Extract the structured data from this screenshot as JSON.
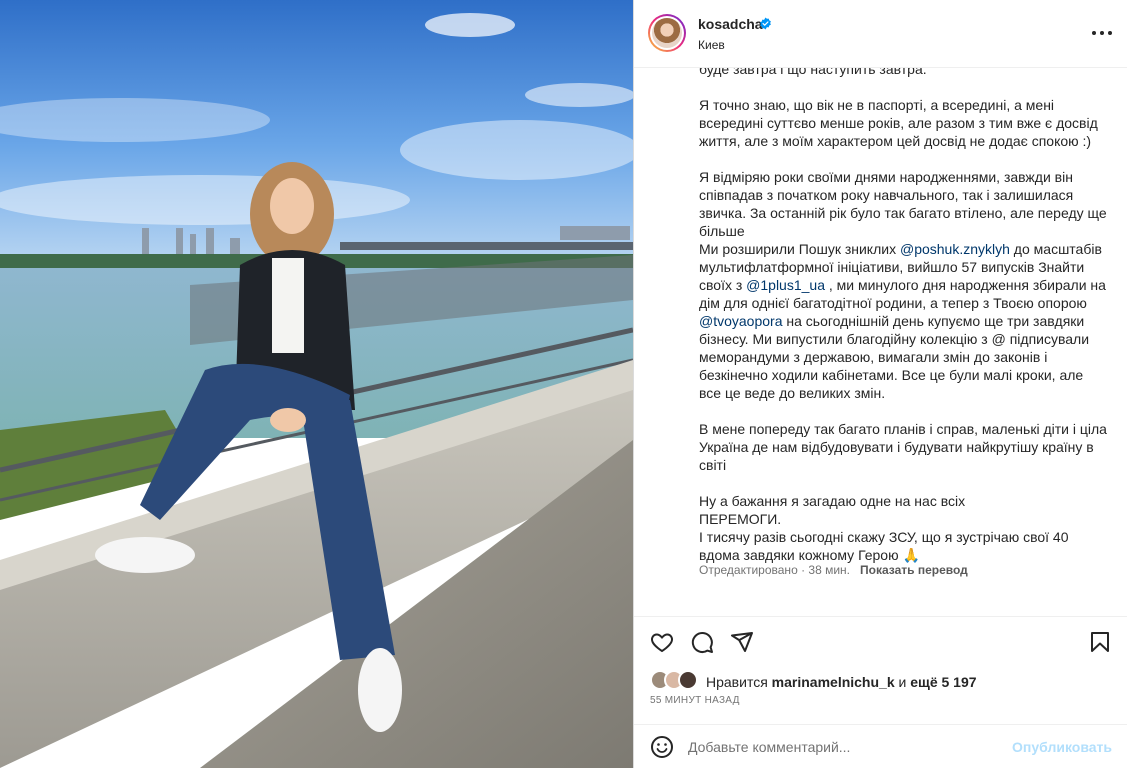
{
  "post": {
    "username": "kosadcha",
    "location": "Киев",
    "verified_color": "#0095f6",
    "caption": {
      "p0": "буде завтра і що наступить завтра.",
      "p1": "Я точно знаю, що вік не в паспорті, а всередині, а мені всередині суттєво менше років, але разом з тим вже є досвід життя, але з моїм характером цей досвід не додає спокою :)",
      "p2": "Я відміряю роки своїми днями народженнями, завжди він співпадав з початком року навчального, так і залишилася звичка. За останній рік було так багато втілено, але переду ще більше",
      "p3_a": "Ми розширили Пошук зниклих ",
      "mention1": "@poshuk.znyklyh",
      "p3_b": " до масштабів мультифлатформної ініціативи, вийшло 57 випусків Знайти своїх з ",
      "mention2": "@1plus1_ua",
      "p3_c": " , ми минулого дня народження збирали на дім для однієї багатодітної родини, а тепер з Твоєю опорою ",
      "mention3": "@tvoyaopora",
      "p3_d": " на сьогоднішній день купуємо ще три завдяки бізнесу. Ми випустили благодійну колекцію з @ підписували меморандуми з державою, вимагали змін до законів і безкінечно ходили кабінетами. Все це були малі кроки, але все це веде до великих змін.",
      "p4": "В мене попереду так багато планів і справ, маленькі діти і ціла Україна де нам відбудовувати і будувати найкрутішу країну в світі",
      "p5_l1": "Ну а бажання я загадаю одне на нас всіх",
      "p5_l2": "ПЕРЕМОГИ.",
      "p5_l3": "І тисячу разів сьогодні скажу ЗСУ, що я зустрічаю свої 40 вдома завдяки кожному Герою 🙏"
    },
    "edited": "Отредактировано · 38 мин.",
    "show_translation": "Показать перевод"
  },
  "actions": {
    "like_icon": "heart-icon",
    "comment_icon": "comment-icon",
    "share_icon": "share-icon",
    "save_icon": "bookmark-icon"
  },
  "likes": {
    "prefix": "Нравится ",
    "user": "marinamelnichu_k",
    "middle": " и ",
    "others": "ещё 5 197",
    "time_ago": "55 МИНУТ НАЗАД"
  },
  "comment": {
    "placeholder": "Добавьте комментарий...",
    "publish": "Опубликовать",
    "publish_color": "#b2dffc"
  }
}
